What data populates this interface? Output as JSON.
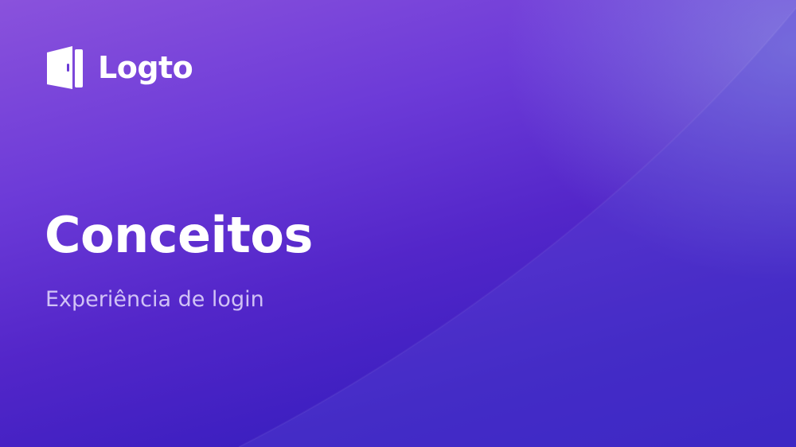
{
  "brand": {
    "name": "Logto",
    "icon": "door-logo-icon"
  },
  "slide": {
    "title": "Conceitos",
    "subtitle": "Experiência de login"
  },
  "colors": {
    "background_top": "#8a52dc",
    "background_bottom": "#3219bd",
    "text": "#ffffff"
  }
}
